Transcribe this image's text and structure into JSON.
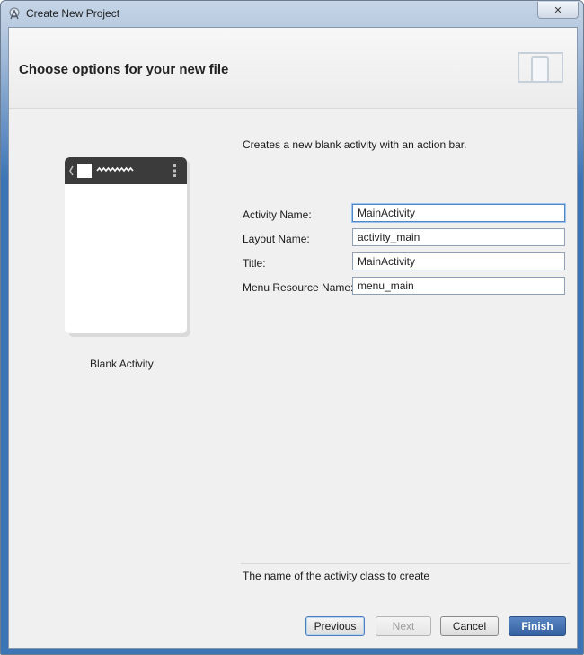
{
  "window": {
    "title": "Create New Project",
    "close_glyph": "✕",
    "app_icon": "android-studio-icon"
  },
  "header": {
    "title": "Choose options for your new file",
    "icon": "device-form-factor-icon"
  },
  "template_preview": {
    "caption": "Blank Activity",
    "icons": [
      "back-chevron-icon",
      "app-icon-placeholder",
      "title-squiggle-icon",
      "overflow-menu-icon"
    ]
  },
  "form": {
    "description": "Creates a new blank activity with an action bar.",
    "fields": [
      {
        "label": "Activity Name:",
        "value": "MainActivity"
      },
      {
        "label": "Layout Name:",
        "value": "activity_main"
      },
      {
        "label": "Title:",
        "value": "MainActivity"
      },
      {
        "label": "Menu Resource Name:",
        "value": "menu_main"
      }
    ]
  },
  "hint": "The name of the activity class to create",
  "buttons": {
    "previous": "Previous",
    "next": "Next",
    "cancel": "Cancel",
    "finish": "Finish"
  },
  "colors": {
    "window_frame": "#3d74b5",
    "finish_button": "#3560a1",
    "focus_border": "#4f88c9"
  }
}
